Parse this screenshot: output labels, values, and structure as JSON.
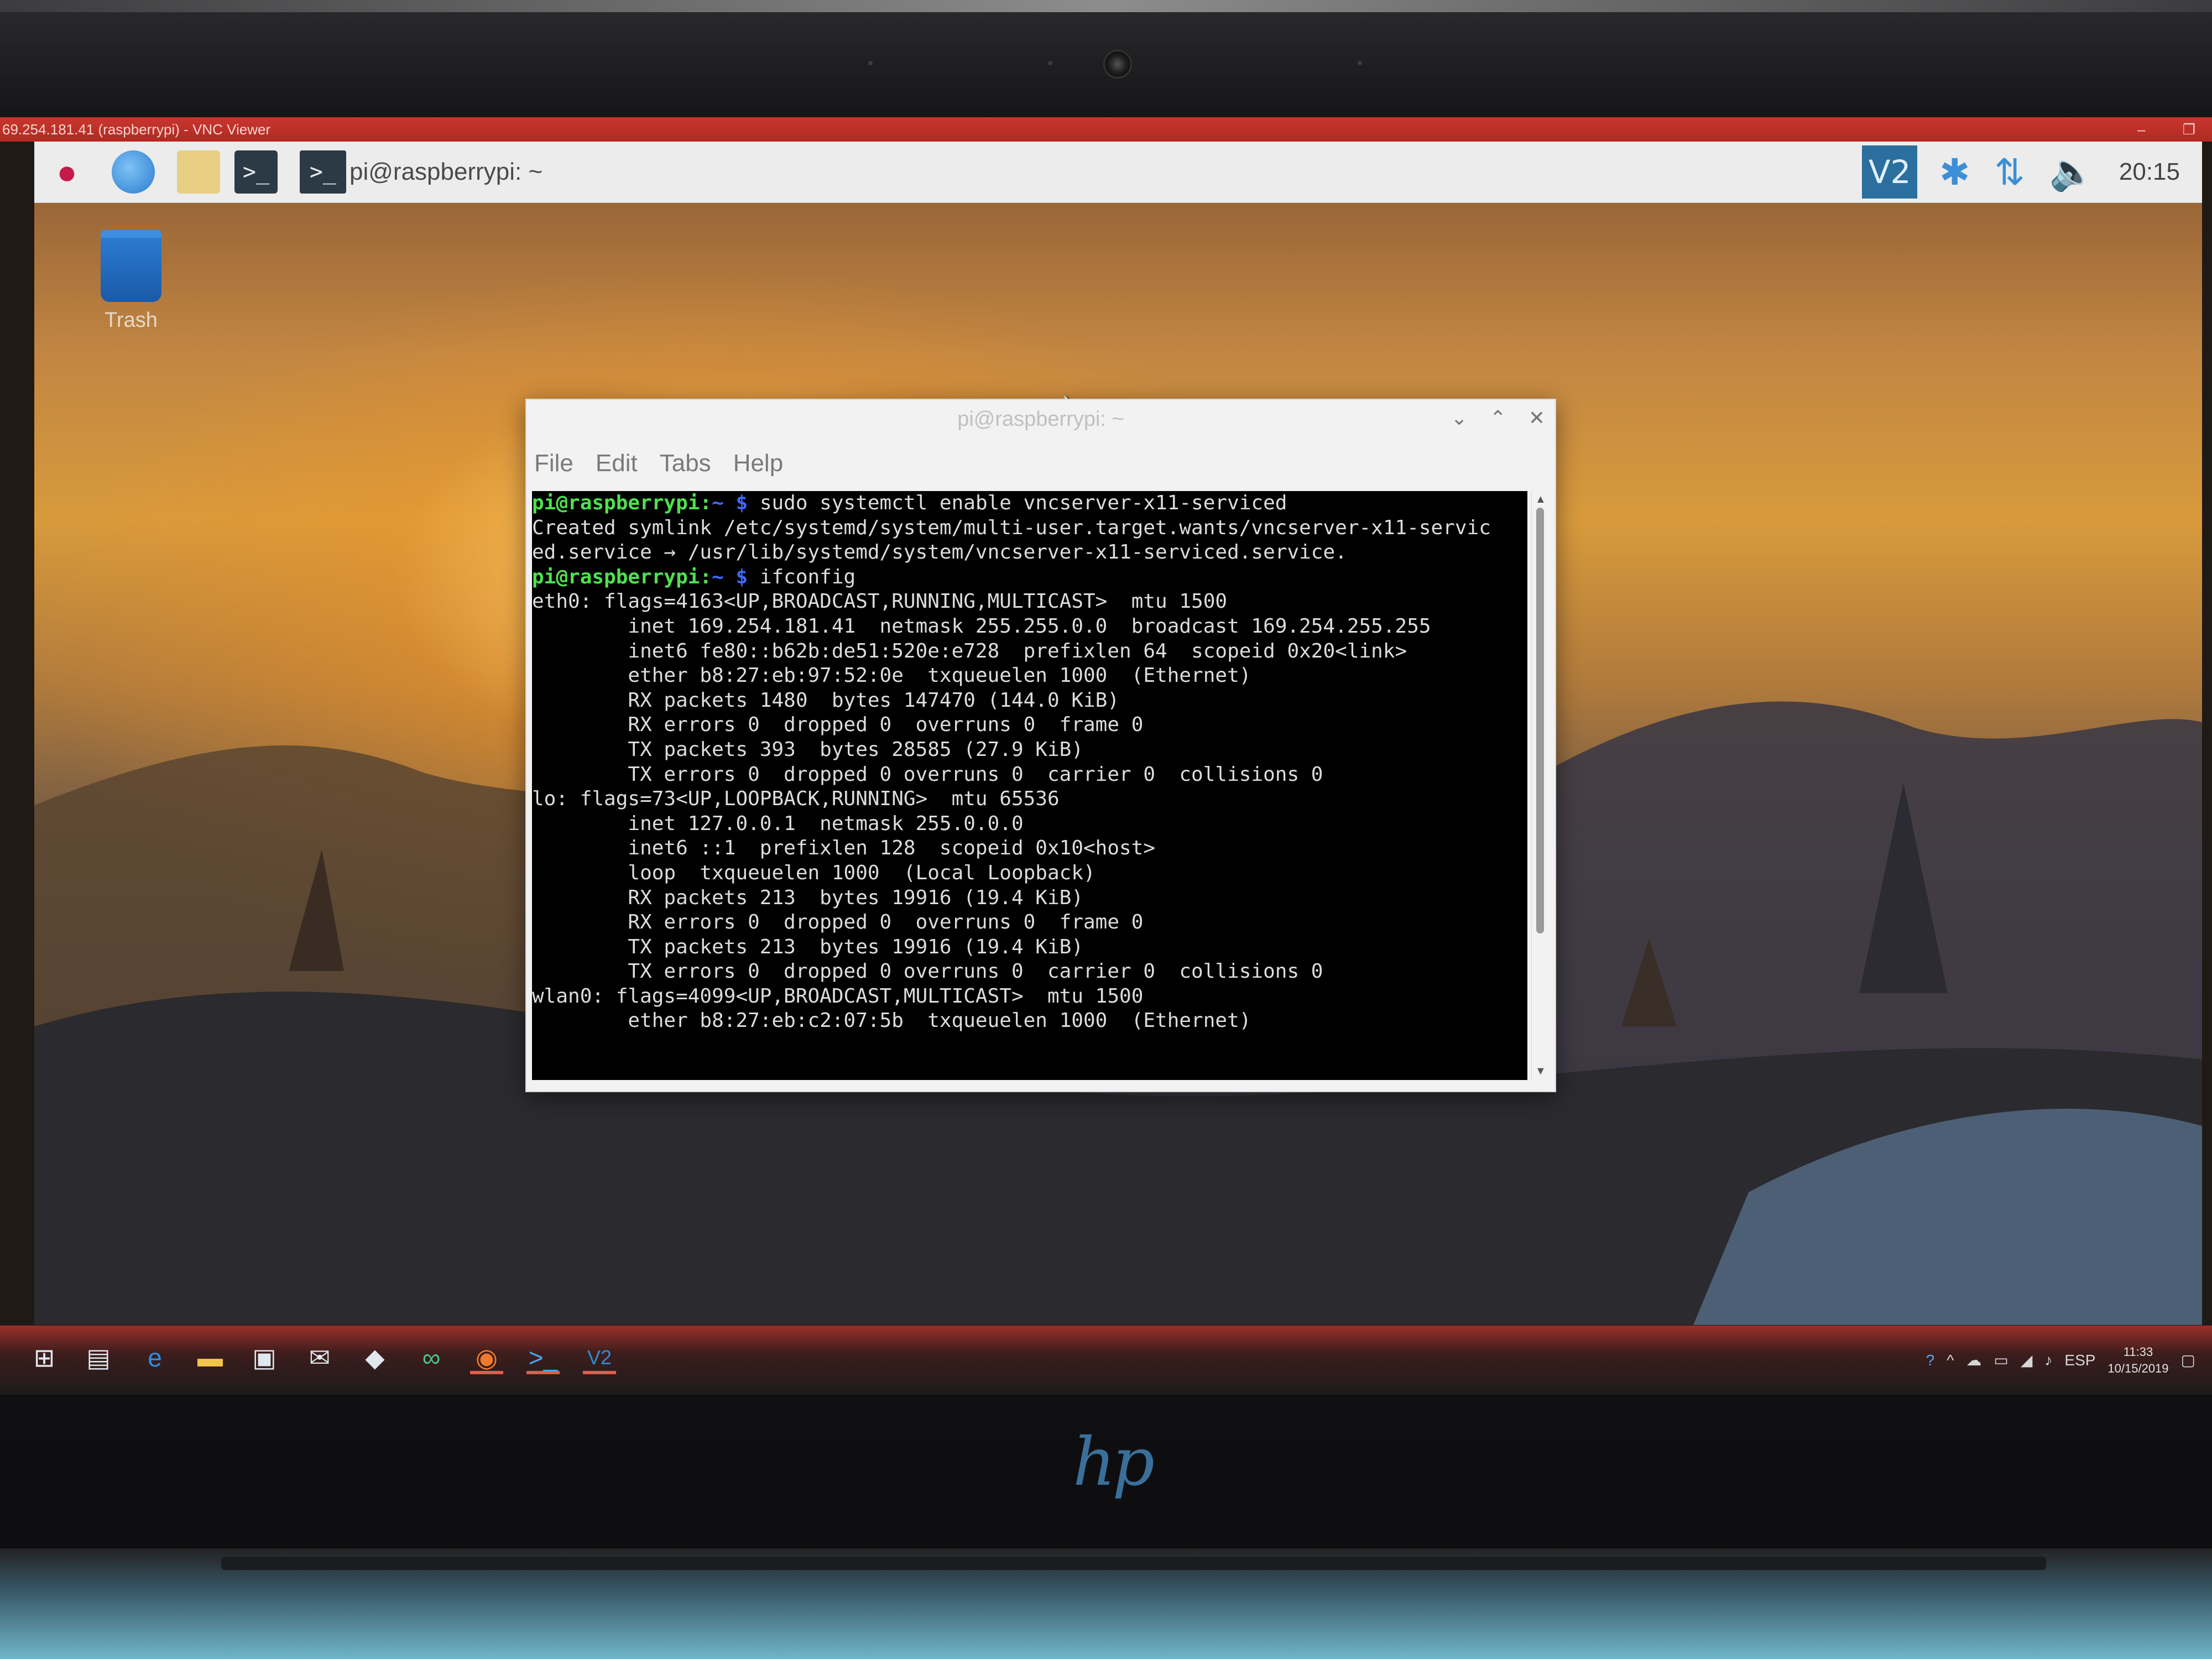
{
  "vnc": {
    "window_title": "69.254.181.41 (raspberrypi) - VNC Viewer",
    "minimize": "–",
    "restore": "❐"
  },
  "pi_panel": {
    "terminal_task_label": "pi@raspberrypi: ~",
    "vnc_tray_label": "V2",
    "clock": "20:15"
  },
  "desktop": {
    "trash_label": "Trash"
  },
  "terminal": {
    "title": "pi@raspberrypi: ~",
    "menu": [
      "File",
      "Edit",
      "Tabs",
      "Help"
    ],
    "lines": [
      {
        "prompt_user": "pi@raspberrypi:",
        "prompt_sym": "~ $",
        "text": " sudo systemctl enable vncserver-x11-serviced"
      },
      {
        "text": "Created symlink /etc/systemd/system/multi-user.target.wants/vncserver-x11-servic"
      },
      {
        "text": "ed.service → /usr/lib/systemd/system/vncserver-x11-serviced.service."
      },
      {
        "prompt_user": "pi@raspberrypi:",
        "prompt_sym": "~ $",
        "text": " ifconfig"
      },
      {
        "text": "eth0: flags=4163<UP,BROADCAST,RUNNING,MULTICAST>  mtu 1500"
      },
      {
        "text": "        inet 169.254.181.41  netmask 255.255.0.0  broadcast 169.254.255.255"
      },
      {
        "text": "        inet6 fe80::b62b:de51:520e:e728  prefixlen 64  scopeid 0x20<link>"
      },
      {
        "text": "        ether b8:27:eb:97:52:0e  txqueuelen 1000  (Ethernet)"
      },
      {
        "text": "        RX packets 1480  bytes 147470 (144.0 KiB)"
      },
      {
        "text": "        RX errors 0  dropped 0  overruns 0  frame 0"
      },
      {
        "text": "        TX packets 393  bytes 28585 (27.9 KiB)"
      },
      {
        "text": "        TX errors 0  dropped 0 overruns 0  carrier 0  collisions 0"
      },
      {
        "text": ""
      },
      {
        "text": "lo: flags=73<UP,LOOPBACK,RUNNING>  mtu 65536"
      },
      {
        "text": "        inet 127.0.0.1  netmask 255.0.0.0"
      },
      {
        "text": "        inet6 ::1  prefixlen 128  scopeid 0x10<host>"
      },
      {
        "text": "        loop  txqueuelen 1000  (Local Loopback)"
      },
      {
        "text": "        RX packets 213  bytes 19916 (19.4 KiB)"
      },
      {
        "text": "        RX errors 0  dropped 0  overruns 0  frame 0"
      },
      {
        "text": "        TX packets 213  bytes 19916 (19.4 KiB)"
      },
      {
        "text": "        TX errors 0  dropped 0 overruns 0  carrier 0  collisions 0"
      },
      {
        "text": ""
      },
      {
        "text": "wlan0: flags=4099<UP,BROADCAST,MULTICAST>  mtu 1500"
      },
      {
        "text": "        ether b8:27:eb:c2:07:5b  txqueuelen 1000  (Ethernet)"
      }
    ]
  },
  "windows_taskbar": {
    "language": "ESP",
    "time": "11:33",
    "date": "10/15/2019",
    "vnc_label": "V2"
  },
  "colors": {
    "vnc_titlebar": "#b8302a",
    "prompt_user": "#4fe04f",
    "prompt_symbol": "#3d6bff"
  }
}
